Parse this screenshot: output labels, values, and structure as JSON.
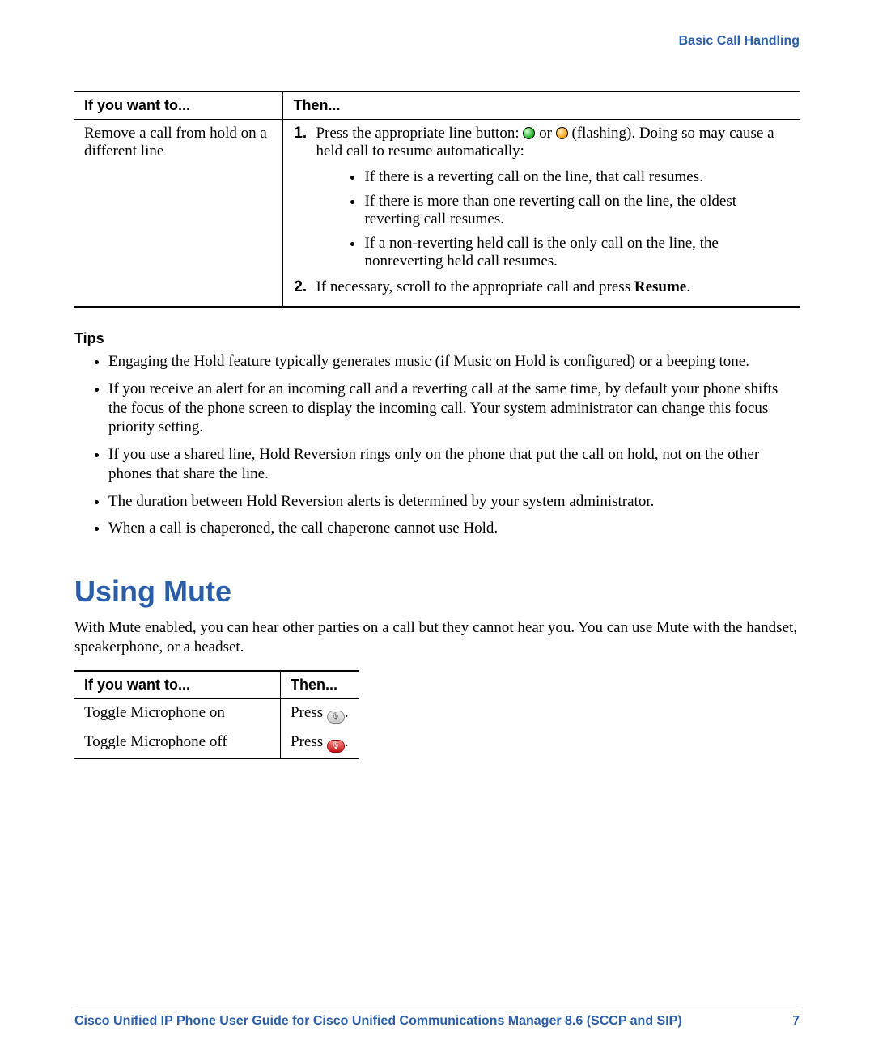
{
  "header": {
    "section": "Basic Call Handling"
  },
  "table1": {
    "head": {
      "col1": "If you want to...",
      "col2": "Then..."
    },
    "row": {
      "want": "Remove a call from hold on a different line",
      "step1_pre": "Press the appropriate line button: ",
      "step1_mid": " or ",
      "step1_post": " (flashing). Doing so may cause a held call to resume automatically:",
      "sub1": "If there is a reverting call on the line, that call resumes.",
      "sub2": "If there is more than one reverting call on the line, the oldest reverting call resumes.",
      "sub3": "If a non-reverting held call is the only call on the line, the nonreverting held call resumes.",
      "step2_pre": "If necessary, scroll to the appropriate call and press ",
      "step2_bold": "Resume",
      "step2_post": "."
    }
  },
  "tips": {
    "heading": "Tips",
    "items": [
      "Engaging the Hold feature typically generates music (if Music on Hold is configured) or a beeping tone.",
      "If you receive an alert for an incoming call and a reverting call at the same time, by default your phone shifts the focus of the phone screen to display the incoming call. Your system administrator can change this focus priority setting.",
      "If you use a shared line, Hold Reversion rings only on the phone that put the call on hold, not on the other phones that share the line.",
      "The duration between Hold Reversion alerts is determined by your system administrator.",
      "When a call is chaperoned, the call chaperone cannot use Hold."
    ]
  },
  "mute": {
    "heading": "Using Mute",
    "intro": "With Mute enabled, you can hear other parties on a call but they cannot hear you. You can use Mute with the handset, speakerphone, or a headset.",
    "table": {
      "head": {
        "col1": "If you want to...",
        "col2": "Then..."
      },
      "rows": [
        {
          "want": "Toggle Microphone on",
          "then_pre": "Press ",
          "then_post": ".",
          "icon": "mute-grey"
        },
        {
          "want": "Toggle Microphone off",
          "then_pre": "Press ",
          "then_post": ".",
          "icon": "mute-red"
        }
      ]
    }
  },
  "footer": {
    "title": "Cisco Unified IP Phone User Guide for Cisco Unified Communications Manager 8.6 (SCCP and SIP)",
    "page": "7"
  }
}
